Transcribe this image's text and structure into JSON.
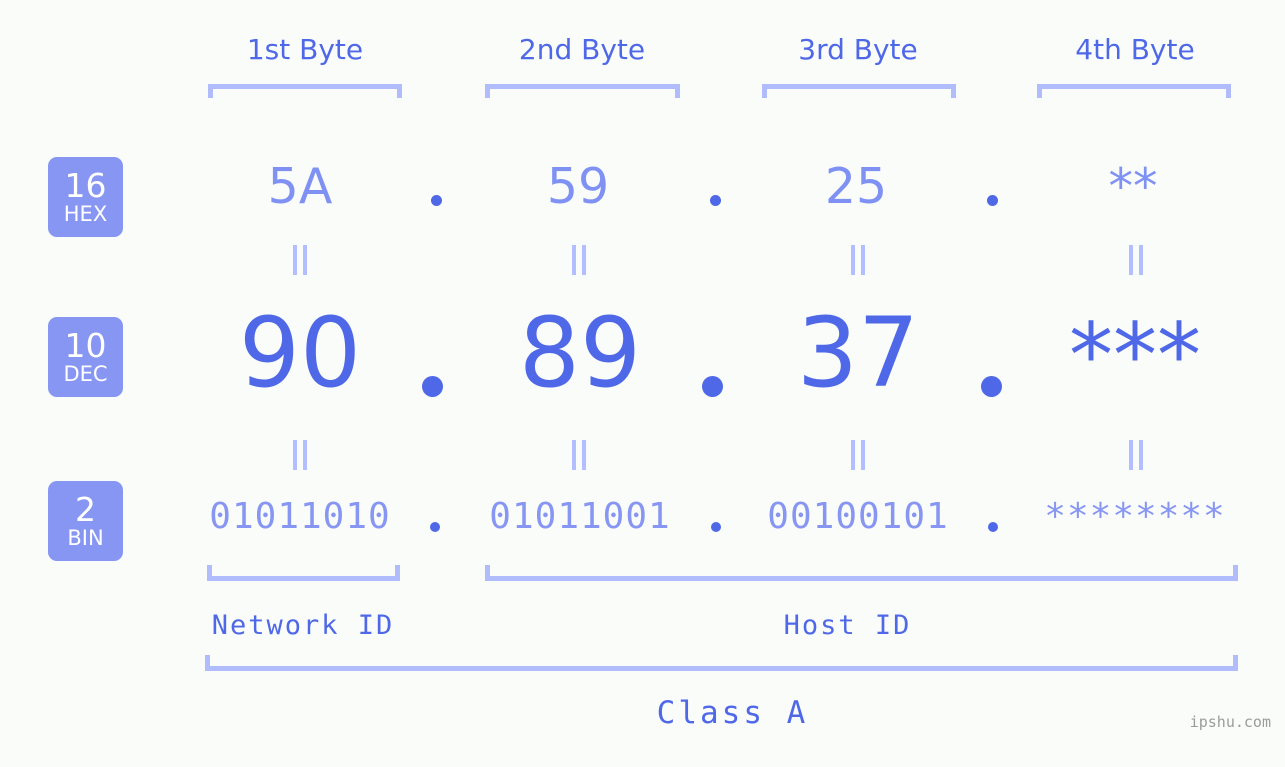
{
  "background_color": "#fafcfa",
  "colors": {
    "accent_light": "#a8b4fb",
    "accent_mid": "#8796f2",
    "accent_dark": "#4f68e8",
    "badge_fill": "#8796f2",
    "badge_text": "#ffffff",
    "bracket": "#b0bcfc",
    "watermark": "#9b9b9b"
  },
  "byte_headers": [
    {
      "label": "1st Byte"
    },
    {
      "label": "2nd Byte"
    },
    {
      "label": "3rd Byte"
    },
    {
      "label": "4th Byte"
    }
  ],
  "rows": [
    {
      "id": "hex",
      "badge": {
        "base": "16",
        "abbr": "HEX"
      },
      "values": [
        "5A",
        "59",
        "25",
        "**"
      ],
      "separator": "."
    },
    {
      "id": "dec",
      "badge": {
        "base": "10",
        "abbr": "DEC"
      },
      "values": [
        "90",
        "89",
        "37",
        "***"
      ],
      "separator": "."
    },
    {
      "id": "bin",
      "badge": {
        "base": "2",
        "abbr": "BIN"
      },
      "values": [
        "01011010",
        "01011001",
        "00100101",
        "********"
      ],
      "separator": "."
    }
  ],
  "equality_symbol": "=",
  "segments": {
    "network_id": "Network ID",
    "host_id": "Host ID",
    "class": "Class A"
  },
  "watermark": "ipshu.com"
}
